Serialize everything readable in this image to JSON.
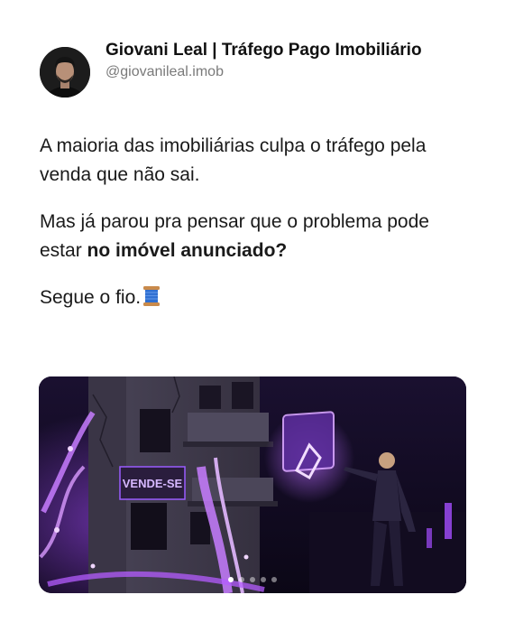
{
  "author": {
    "name": "Giovani Leal | Tráfego Pago Imobiliário",
    "handle": "@giovanileal.imob"
  },
  "post": {
    "paragraph1": "A maioria das imobiliárias culpa o tráfego pela venda que não sai.",
    "paragraph2_start": "Mas já parou pra pensar que o problema pode estar ",
    "paragraph2_bold": "no imóvel anunciado?",
    "paragraph3": "Segue o fio.",
    "paragraph3_emoji": "spool-of-thread-icon"
  },
  "media": {
    "sign_text": "VENDE-SE",
    "carousel_total": 5,
    "carousel_active": 1
  },
  "colors": {
    "neon_purple": "#b45cff",
    "handle_gray": "#7a7a7a"
  }
}
